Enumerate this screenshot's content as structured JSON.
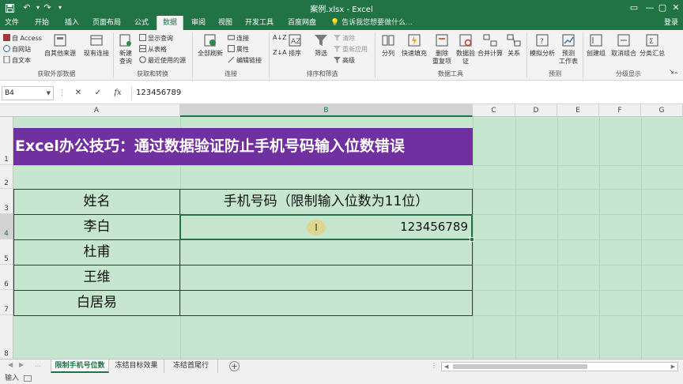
{
  "window": {
    "title": "案例.xlsx - Excel",
    "save_icon": "save-icon",
    "undo_icon": "undo-icon",
    "redo_icon": "redo-icon"
  },
  "tabs": [
    "文件",
    "开始",
    "插入",
    "页面布局",
    "公式",
    "数据",
    "审阅",
    "视图",
    "开发工具",
    "百度网盘"
  ],
  "active_tab": "数据",
  "tell_me": "告诉我您想要做什么...",
  "sign_in": "登录",
  "ribbon": {
    "get_external": {
      "from_access": "自 Access",
      "from_web": "自网站",
      "from_text": "自文本",
      "other_sources": "自其他来源",
      "existing": "现有连接",
      "label": "获取外部数据"
    },
    "get_transform": {
      "new_query": "新建\n查询",
      "show_queries": "显示查询",
      "from_table": "从表格",
      "recent_sources": "最近使用的源",
      "label": "获取和转换"
    },
    "connections": {
      "refresh_all": "全部刷新",
      "connections": "连接",
      "properties": "属性",
      "edit_links": "编辑链接",
      "label": "连接"
    },
    "sort_filter": {
      "sort": "排序",
      "filter": "筛选",
      "clear": "清除",
      "reapply": "重新应用",
      "advanced": "高级",
      "label": "排序和筛选"
    },
    "data_tools": {
      "text_to_columns": "分列",
      "flash_fill": "快速填充",
      "remove_dup": "删除\n重复项",
      "validation": "数据验\n证",
      "consolidate": "合并计算",
      "relationships": "关系",
      "label": "数据工具"
    },
    "forecast": {
      "what_if": "模拟分析",
      "forecast_sheet": "预测\n工作表",
      "label": "预测"
    },
    "outline": {
      "group": "创建组",
      "ungroup": "取消组合",
      "subtotal": "分类汇总",
      "label": "分级显示"
    }
  },
  "formula_bar": {
    "name_box": "B4",
    "cancel": "✕",
    "enter": "✓",
    "fx": "fx",
    "content": "123456789"
  },
  "columns": [
    "A",
    "B",
    "C",
    "D",
    "E",
    "F",
    "G"
  ],
  "rows": [
    "1",
    "2",
    "3",
    "4",
    "5",
    "6",
    "7",
    "8"
  ],
  "sheet": {
    "title": "Excel办公技巧：通过数据验证防止手机号码输入位数错误",
    "header_name": "姓名",
    "header_phone": "手机号码（限制输入位数为11位）",
    "names": [
      "李白",
      "杜甫",
      "王维",
      "白居易"
    ],
    "active_value": "123456789"
  },
  "sheet_tabs": [
    "限制手机号位数",
    "冻结目标效果",
    "冻结首尾行"
  ],
  "active_sheet": "限制手机号位数",
  "status": "输入",
  "colors": {
    "excel_green": "#217346",
    "title_purple": "#7030a0",
    "sheet_bg": "#c7e6cf"
  }
}
